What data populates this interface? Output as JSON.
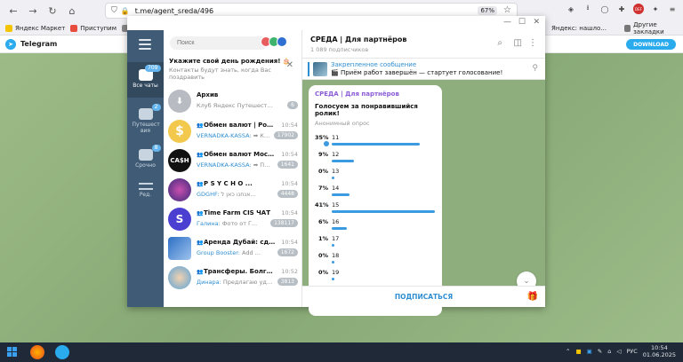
{
  "browser": {
    "url": "t.me/agent_sreda/496",
    "zoom": "67%",
    "bookmarks": [
      {
        "label": "Яндекс Маркет",
        "color": "#f5c400"
      },
      {
        "label": "Приступим",
        "color": "#e74c3c"
      },
      {
        "label": "Во",
        "color": "#888888"
      }
    ],
    "bookmark_right_fragment": "Яндекс: нашло...",
    "bookmark_other": "Другие закладки",
    "ext_badge": "DEF"
  },
  "tg_web": {
    "title": "Telegram",
    "download_label": "DOWNLOAD"
  },
  "rail": {
    "items": [
      {
        "label": "Все чаты",
        "badge": "709"
      },
      {
        "label": "Путешест вия",
        "badge": "2"
      },
      {
        "label": "Срочно",
        "badge": "8"
      },
      {
        "label": "Ред.",
        "badge": ""
      }
    ]
  },
  "chat_list": {
    "search_placeholder": "Поиск",
    "birthday_title": "Укажите свой день рождения! 🎂",
    "birthday_text": "Контакты будут знать, когда Вас поздравить",
    "chats": [
      {
        "name": "Архив",
        "time": "",
        "sender": "",
        "preview": "Клуб Яндекс Путешествен...",
        "count": "6",
        "avatar_color": "#b8bcc2",
        "avatar_text": "⬇",
        "group": false
      },
      {
        "name": "Обмен валют | Росс...",
        "time": "10:54",
        "sender": "VERNADKA-KASSA:",
        "preview": "➡ Ка...",
        "count": "17902",
        "avatar_color": "#f2c94c",
        "avatar_text": "$",
        "group": true
      },
      {
        "name": "Обмен валют Москва",
        "time": "10:54",
        "sender": "VERNADKA-KASSA:",
        "preview": "➡ По...",
        "count": "1641",
        "avatar_color": "#111111",
        "avatar_text": "CA$H",
        "group": true
      },
      {
        "name": "P S Y C H O ...",
        "time": "10:54",
        "sender": "GDGHF:",
        "preview": "אנחנו כאן ל...",
        "count": "4448",
        "avatar_color": "#6b3fa0",
        "avatar_text": "",
        "group": true
      },
      {
        "name": "Time Farm CIS ЧАТ",
        "time": "10:54",
        "sender": "Галина:",
        "preview": "Фото от Г...",
        "count": "138117",
        "avatar_color": "#4b3fd1",
        "avatar_text": "S",
        "group": true
      },
      {
        "name": "Аренда Дубай: сдам...",
        "time": "10:54",
        "sender": "Group Booster:",
        "preview": "Add ...",
        "count": "1672",
        "avatar_color": "#2d6fc4",
        "avatar_text": "",
        "group": true
      },
      {
        "name": "Трансферы. Болгар...",
        "time": "10:52",
        "sender": "Динара:",
        "preview": "Предлагаю уда...",
        "count": "3813",
        "avatar_color": "#5ba3d9",
        "avatar_text": "",
        "group": true
      }
    ]
  },
  "conversation": {
    "title": "СРЕДА | Для партнёров",
    "subscribers": "1 089 подписчиков",
    "pinned_title": "Закрепленное сообщение",
    "pinned_text": "🎬 Приём работ завершён — стартует голосование!",
    "subscribe_label": "ПОДПИСАТЬСЯ"
  },
  "poll": {
    "source": "СРЕДА | Для партнёров",
    "question": "Голосуем за понравившийся ролик!",
    "kind": "Анонимный опрос",
    "options": [
      {
        "pct": "35%",
        "label": "11",
        "value": 35,
        "chosen": true
      },
      {
        "pct": "9%",
        "label": "12",
        "value": 9,
        "chosen": false
      },
      {
        "pct": "0%",
        "label": "13",
        "value": 0,
        "chosen": false
      },
      {
        "pct": "7%",
        "label": "14",
        "value": 7,
        "chosen": false
      },
      {
        "pct": "41%",
        "label": "15",
        "value": 41,
        "chosen": false
      },
      {
        "pct": "6%",
        "label": "16",
        "value": 6,
        "chosen": false
      },
      {
        "pct": "1%",
        "label": "17",
        "value": 1,
        "chosen": false
      },
      {
        "pct": "0%",
        "label": "18",
        "value": 0,
        "chosen": false
      },
      {
        "pct": "0%",
        "label": "19",
        "value": 0,
        "chosen": false
      }
    ]
  },
  "taskbar": {
    "lang": "РУС",
    "time": "10:54",
    "date": "01.06.2025"
  }
}
